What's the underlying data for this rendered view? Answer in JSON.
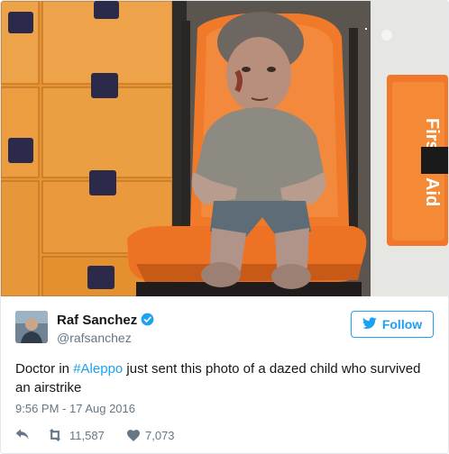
{
  "tweet": {
    "display_name": "Raf Sanchez",
    "handle": "@rafsanchez",
    "follow_label": "Follow",
    "text_before": "Doctor in ",
    "hashtag": "#Aleppo",
    "text_after": " just sent this photo of a dazed child who survived an airstrike",
    "timestamp": "9:56 PM - 17 Aug 2016",
    "retweets": "11,587",
    "likes": "7,073"
  },
  "photo": {
    "description_icons": [
      "first-aid-kit",
      "ambulance-seat"
    ],
    "sign_text": "First Aid"
  },
  "icons": {
    "verified": "verified-badge-icon",
    "follow": "bird-icon",
    "reply": "reply-icon",
    "retweet": "retweet-icon",
    "like": "heart-icon"
  },
  "colors": {
    "accent": "#1da1f2",
    "muted": "#657786",
    "text": "#14171a",
    "cabinet_orange": "#e9922e",
    "seat_orange": "#f07a2a"
  }
}
